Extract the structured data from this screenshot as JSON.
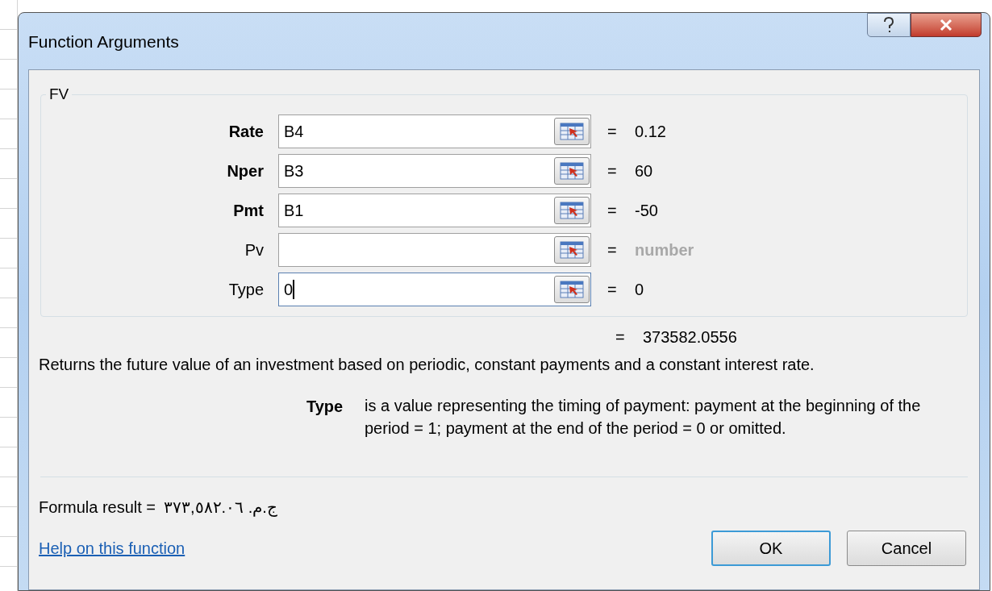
{
  "window": {
    "title": "Function Arguments"
  },
  "group": {
    "title": "FV"
  },
  "arguments": [
    {
      "label": "Rate",
      "required": true,
      "value": "B4",
      "result": "0.12",
      "result_hint": false,
      "focused": false
    },
    {
      "label": "Nper",
      "required": true,
      "value": "B3",
      "result": "60",
      "result_hint": false,
      "focused": false
    },
    {
      "label": "Pmt",
      "required": true,
      "value": "B1",
      "result": "-50",
      "result_hint": false,
      "focused": false
    },
    {
      "label": "Pv",
      "required": false,
      "result": "number",
      "result_hint": true,
      "focused": false
    },
    {
      "label": "Type",
      "required": false,
      "value": "0",
      "result": "0",
      "result_hint": false,
      "focused": true
    }
  ],
  "equals_sign": "=",
  "total_result": "373582.0556",
  "description": "Returns the future value of an investment based on periodic, constant payments and a constant interest rate.",
  "argument_help": {
    "name": "Type",
    "text": "is a value representing the timing of payment: payment at the beginning of the period = 1; payment at the end of the period = 0 or omitted."
  },
  "formula_result": {
    "label": "Formula result =",
    "value": "ج.م. ٣٧٣,٥٨٢.٠٦"
  },
  "help_link": "Help on this function",
  "buttons": [
    {
      "label": "OK",
      "default": true
    },
    {
      "label": "Cancel",
      "default": false
    }
  ]
}
